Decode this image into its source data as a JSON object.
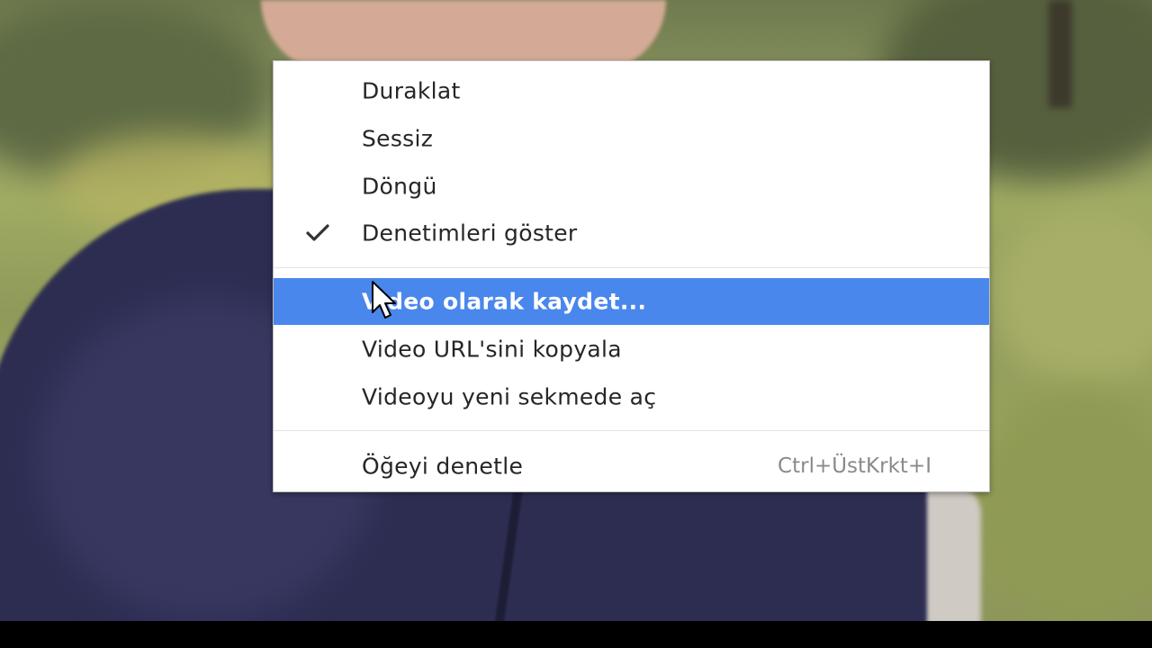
{
  "video": {
    "description_colors": {
      "jacket": "#2d2d52",
      "grass": "#9aa45e",
      "skin": "#d4aa96"
    }
  },
  "context_menu": {
    "highlight_color": "#4a87ec",
    "items": [
      {
        "label": "Duraklat",
        "checked": false,
        "highlighted": false
      },
      {
        "label": "Sessiz",
        "checked": false,
        "highlighted": false
      },
      {
        "label": "Döngü",
        "checked": false,
        "highlighted": false
      },
      {
        "label": "Denetimleri göster",
        "checked": true,
        "highlighted": false,
        "check_icon": "checkmark-icon"
      },
      {
        "label": "Video olarak kaydet...",
        "checked": false,
        "highlighted": true
      },
      {
        "label": "Video URL'sini kopyala",
        "checked": false,
        "highlighted": false
      },
      {
        "label": "Videoyu yeni sekmede aç",
        "checked": false,
        "highlighted": false
      },
      {
        "label": "Öğeyi denetle",
        "shortcut": "Ctrl+ÜstKrkt+I",
        "checked": false,
        "highlighted": false
      }
    ]
  },
  "cursor": {
    "icon": "mouse-pointer-icon"
  }
}
